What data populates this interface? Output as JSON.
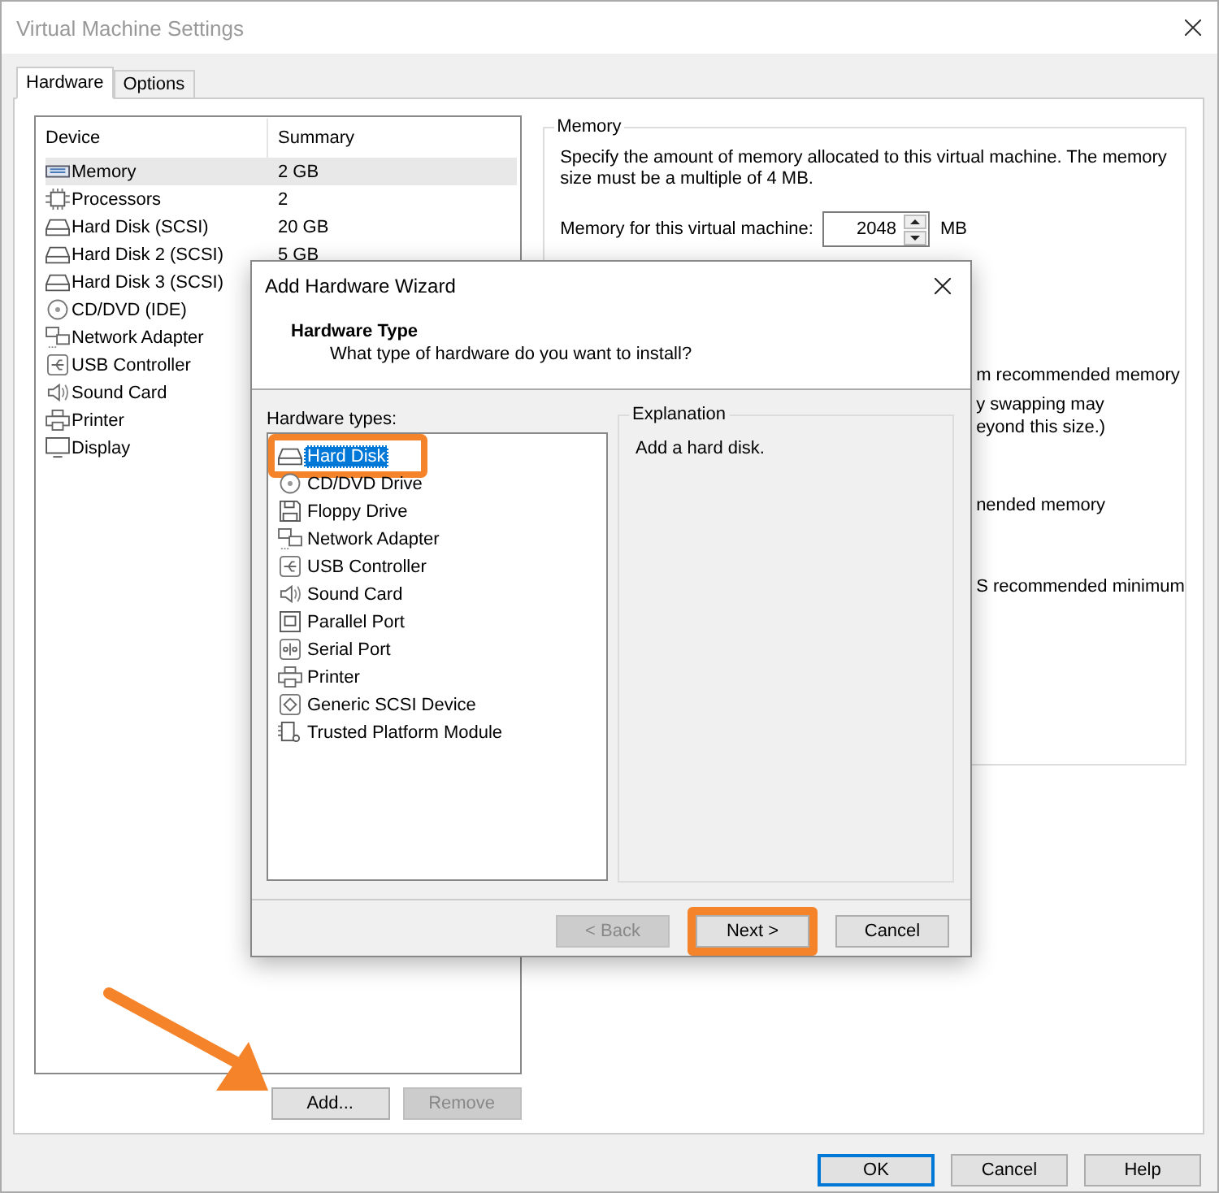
{
  "window": {
    "title": "Virtual Machine Settings"
  },
  "tabs": [
    {
      "label": "Hardware",
      "selected": true
    },
    {
      "label": "Options",
      "selected": false
    }
  ],
  "device_table": {
    "columns": [
      "Device",
      "Summary"
    ],
    "rows": [
      {
        "kind": "memory",
        "device": "Memory",
        "summary": "2 GB",
        "selected": true
      },
      {
        "kind": "cpu",
        "device": "Processors",
        "summary": "2",
        "selected": false
      },
      {
        "kind": "disk",
        "device": "Hard Disk (SCSI)",
        "summary": "20 GB",
        "selected": false
      },
      {
        "kind": "disk",
        "device": "Hard Disk 2 (SCSI)",
        "summary": "5 GB",
        "selected": false
      },
      {
        "kind": "disk",
        "device": "Hard Disk 3 (SCSI)",
        "summary": "",
        "selected": false
      },
      {
        "kind": "cd",
        "device": "CD/DVD (IDE)",
        "summary": "",
        "selected": false
      },
      {
        "kind": "network",
        "device": "Network Adapter",
        "summary": "",
        "selected": false
      },
      {
        "kind": "usb",
        "device": "USB Controller",
        "summary": "",
        "selected": false
      },
      {
        "kind": "sound",
        "device": "Sound Card",
        "summary": "",
        "selected": false
      },
      {
        "kind": "printer",
        "device": "Printer",
        "summary": "",
        "selected": false
      },
      {
        "kind": "display",
        "device": "Display",
        "summary": "",
        "selected": false
      }
    ]
  },
  "device_buttons": [
    {
      "label": "Add...",
      "disabled": false
    },
    {
      "label": "Remove",
      "disabled": true
    }
  ],
  "memory_group": {
    "title": "Memory",
    "description": "Specify the amount of memory allocated to this virtual machine. The memory size must be a multiple of 4 MB.",
    "field_label": "Memory for this virtual machine:",
    "value": "2048",
    "unit": "MB",
    "partial_lines": [
      "m recommended memory",
      "y swapping may",
      "eyond this size.)",
      "nended memory",
      "S recommended minimum"
    ]
  },
  "dialog": {
    "title": "Add Hardware Wizard",
    "heading": "Hardware Type",
    "subheading": "What type of hardware do you want to install?",
    "list_label": "Hardware types:",
    "items": [
      {
        "kind": "disk",
        "label": "Hard Disk",
        "selected": true,
        "highlighted": true
      },
      {
        "kind": "cd",
        "label": "CD/DVD Drive",
        "selected": false,
        "highlighted": false
      },
      {
        "kind": "floppy",
        "label": "Floppy Drive",
        "selected": false,
        "highlighted": false
      },
      {
        "kind": "network",
        "label": "Network Adapter",
        "selected": false,
        "highlighted": false
      },
      {
        "kind": "usb",
        "label": "USB Controller",
        "selected": false,
        "highlighted": false
      },
      {
        "kind": "sound",
        "label": "Sound Card",
        "selected": false,
        "highlighted": false
      },
      {
        "kind": "parallel",
        "label": "Parallel Port",
        "selected": false,
        "highlighted": false
      },
      {
        "kind": "serial",
        "label": "Serial Port",
        "selected": false,
        "highlighted": false
      },
      {
        "kind": "printer",
        "label": "Printer",
        "selected": false,
        "highlighted": false
      },
      {
        "kind": "scsi",
        "label": "Generic SCSI Device",
        "selected": false,
        "highlighted": false
      },
      {
        "kind": "tpm",
        "label": "Trusted Platform Module",
        "selected": false,
        "highlighted": false
      }
    ],
    "explanation_title": "Explanation",
    "explanation": "Add a hard disk.",
    "buttons": [
      {
        "label": "< Back",
        "disabled": true,
        "highlighted": false
      },
      {
        "label": "Next >",
        "disabled": false,
        "highlighted": true
      },
      {
        "label": "Cancel",
        "disabled": false,
        "highlighted": false
      }
    ]
  },
  "footer_buttons": [
    {
      "label": "OK",
      "default": true
    },
    {
      "label": "Cancel",
      "default": false
    },
    {
      "label": "Help",
      "default": false
    }
  ],
  "annotations": [
    {
      "kind": "arrow"
    }
  ]
}
